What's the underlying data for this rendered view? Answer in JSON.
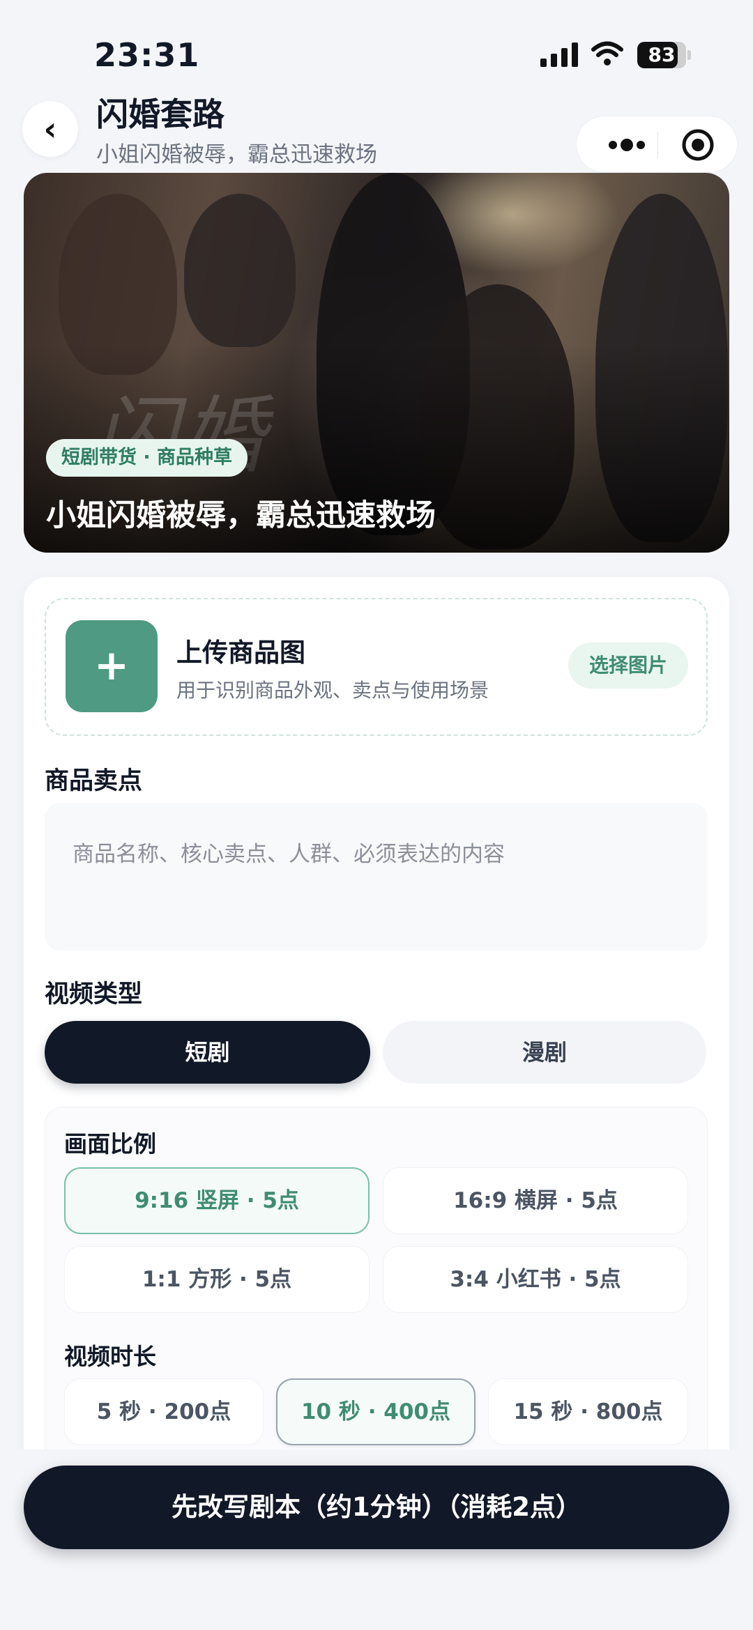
{
  "status_bar": {
    "time": "23:31",
    "battery": "83",
    "battery_level": 0.83
  },
  "header": {
    "title": "闪婚套路",
    "subtitle": "小姐闪婚被辱，霸总迅速救场",
    "back_icon": "chevron-left-icon"
  },
  "banner": {
    "tag": "短剧带货 · 商品种草",
    "title": "小姐闪婚被辱，霸总迅速救场",
    "watermark": "闪婚"
  },
  "upload": {
    "plus": "+",
    "title": "上传商品图",
    "description": "用于识别商品外观、卖点与使用场景",
    "button": "选择图片"
  },
  "selling_points": {
    "label": "商品卖点",
    "placeholder": "商品名称、核心卖点、人群、必须表达的内容"
  },
  "video_type": {
    "label": "视频类型",
    "options": [
      "短剧",
      "漫剧"
    ],
    "selected": "短剧"
  },
  "aspect_ratio": {
    "label": "画面比例",
    "options": [
      "9:16 竖屏 · 5点",
      "16:9 横屏 · 5点",
      "1:1 方形 · 5点",
      "3:4 小红书 · 5点"
    ],
    "selected": "9:16 竖屏 · 5点"
  },
  "duration": {
    "label": "视频时长",
    "options": [
      "5 秒 · 200点",
      "10 秒 · 400点",
      "15 秒 · 800点"
    ],
    "selected": "10 秒 · 400点"
  },
  "cta": {
    "label": "先改写剧本（约1分钟）（消耗2点）"
  },
  "colors": {
    "accent": "#4f9a82",
    "dark": "#111827",
    "background": "#f4f5f8"
  }
}
